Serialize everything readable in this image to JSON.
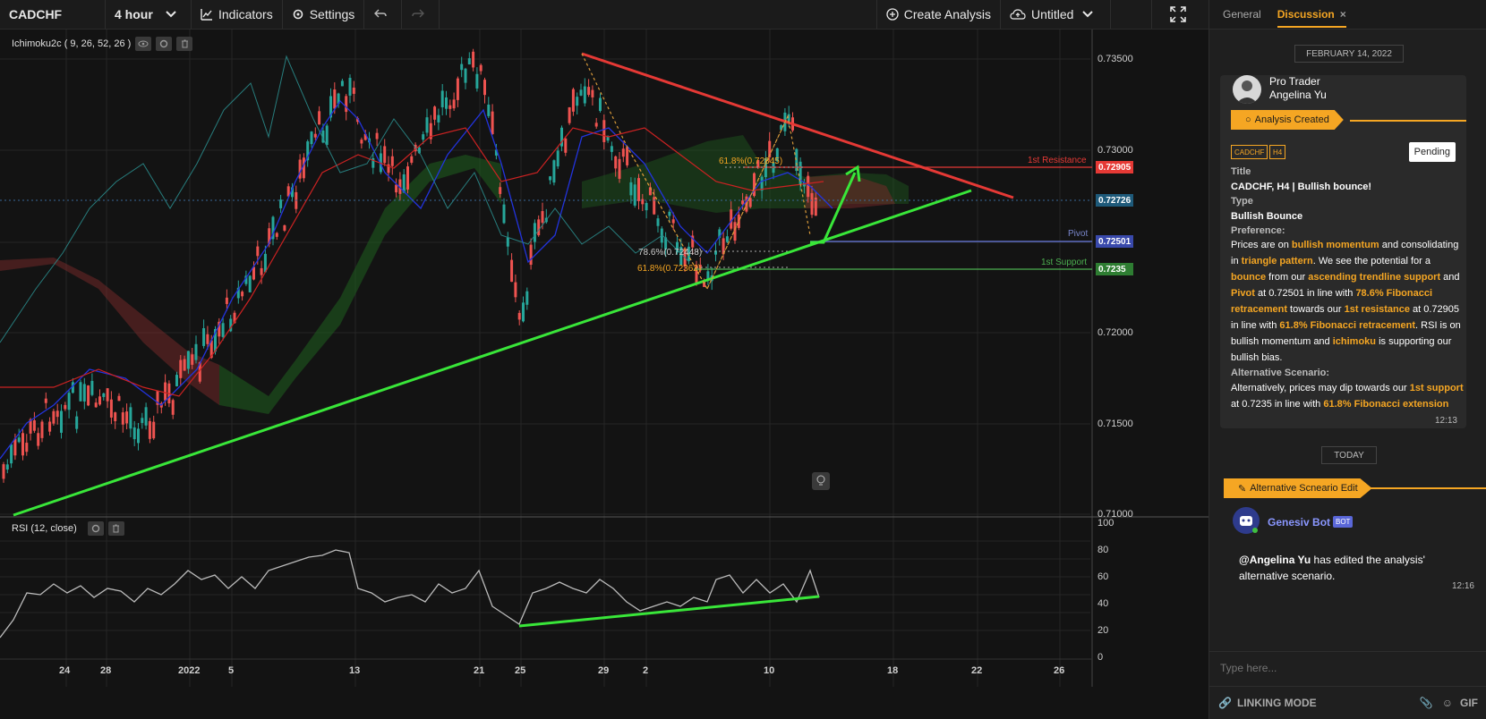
{
  "toolbar": {
    "symbol": "CADCHF",
    "interval": "4 hour",
    "indicators_label": "Indicators",
    "settings_label": "Settings",
    "create_analysis_label": "Create Analysis",
    "layout_name": "Untitled"
  },
  "indicators": {
    "main": "Ichimoku2c ( 9, 26, 52, 26 )",
    "sub": "RSI (12, close)"
  },
  "price_axis": {
    "labels": [
      "0.73500",
      "0.73000",
      "0.72000",
      "0.71500",
      "0.71000"
    ],
    "tags": {
      "resistance_value": "0.72905",
      "current_value": "0.72726",
      "pivot_value": "0.72501",
      "support_value": "0.7235"
    }
  },
  "rsi_axis": {
    "labels": [
      "100",
      "80",
      "60",
      "40",
      "20",
      "0"
    ]
  },
  "time_axis": {
    "labels": [
      "24",
      "28",
      "2022",
      "5",
      "13",
      "21",
      "25",
      "29",
      "2",
      "10",
      "18",
      "22",
      "26"
    ]
  },
  "annotations": {
    "resistance": "1st Resistance",
    "pivot": "Pivot",
    "support": "1st Support",
    "fib_786": "78.6%(0.72448)",
    "fib_618_low": "61.8%(0.72362)",
    "fib_618_high": "61.8%(0.72845)"
  },
  "colors": {
    "accent": "#f5a623",
    "resistance": "#e53935",
    "support_green": "#4caf50",
    "pivot_blue": "#5c6bc0",
    "trend_green": "#39e639"
  },
  "panel": {
    "tabs": [
      "General",
      "Discussion"
    ],
    "date_header": "FEBRUARY 14, 2022",
    "author_role": "Pro Trader",
    "author_name": "Angelina Yu",
    "analysis_tag": "Analysis Created",
    "mini_tags": [
      "CADCHF",
      "H4"
    ],
    "status": "Pending",
    "title_label": "Title",
    "title_value": "CADCHF, H4 | Bullish bounce!",
    "type_label": "Type",
    "type_value": "Bullish Bounce",
    "preference_label": "Preference:",
    "alt_label": "Alternative Scenario:",
    "msg_time": "12:13",
    "today": "TODAY",
    "edit_tag": "Alternative Scneario Edit",
    "bot_name": "Genesiv Bot",
    "bot_badge": "BOT",
    "mention": "@Angelina Yu",
    "edit_msg": "has edited the analysis' alternative scenario.",
    "edit_time": "12:16",
    "input_placeholder": "Type here...",
    "linking_mode": "LINKING MODE",
    "gif": "GIF"
  }
}
